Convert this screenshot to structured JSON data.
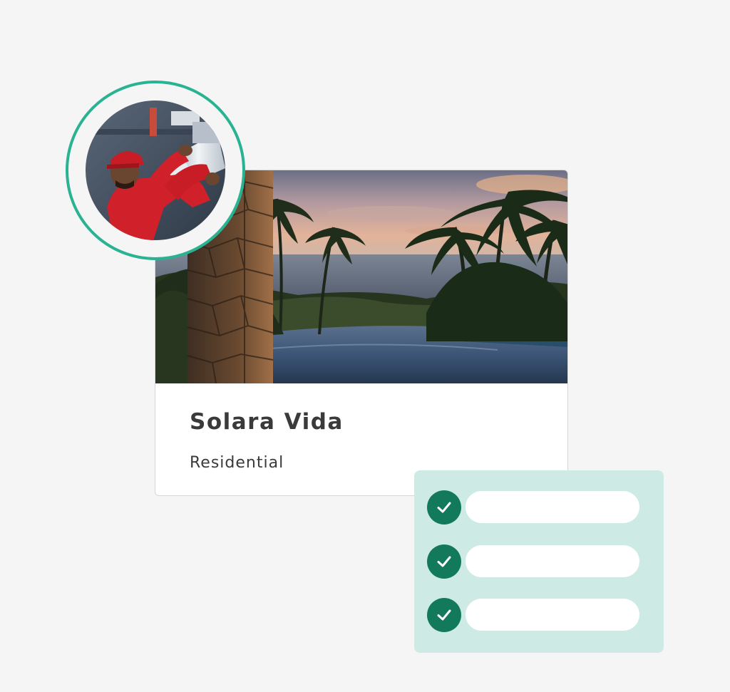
{
  "property_card": {
    "title": "Solara Vida",
    "category": "Residential",
    "photo": "infinity-pool-ocean-sunset-palm-trees"
  },
  "avatar": {
    "photo": "technician-red-cap-installing-duct",
    "ring_color": "#2ab392"
  },
  "checklist": {
    "items": [
      {
        "checked": true,
        "icon": "check-icon"
      },
      {
        "checked": true,
        "icon": "check-icon"
      },
      {
        "checked": true,
        "icon": "check-icon"
      }
    ],
    "panel_color": "#cdebe4",
    "check_color": "#127a5a"
  }
}
